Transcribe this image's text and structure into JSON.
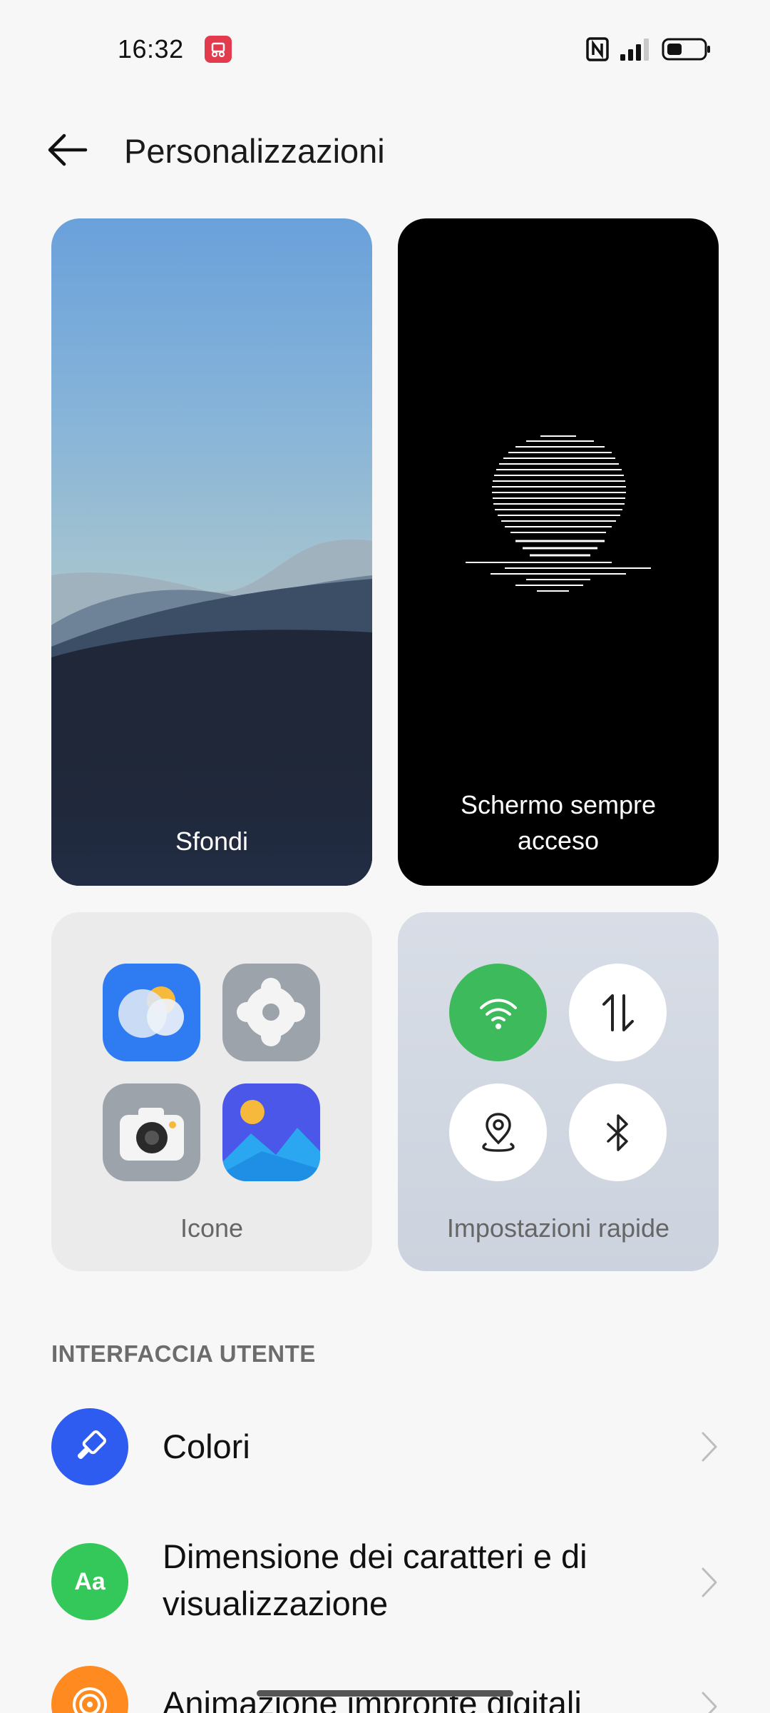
{
  "status_bar": {
    "time": "16:32"
  },
  "header": {
    "title": "Personalizzazioni"
  },
  "cards": {
    "wallpaper_label": "Sfondi",
    "aod_label_line1": "Schermo sempre",
    "aod_label_line2": "acceso",
    "icons_label": "Icone",
    "quick_settings_label": "Impostazioni rapide"
  },
  "section": {
    "title": "INTERFACCIA UTENTE"
  },
  "list": {
    "colors": "Colori",
    "font_line1": "Dimensione dei caratteri e di",
    "font_line2": "visualizzazione",
    "font_icon_text": "Aa",
    "fingerprint": "Animazione impronte digitali"
  },
  "colors": {
    "background": "#f7f7f7",
    "colori_icon": "#2e5bf0",
    "font_icon": "#34c759",
    "fingerprint_icon": "#ff8a1f",
    "wifi_active": "#3dba5b"
  }
}
